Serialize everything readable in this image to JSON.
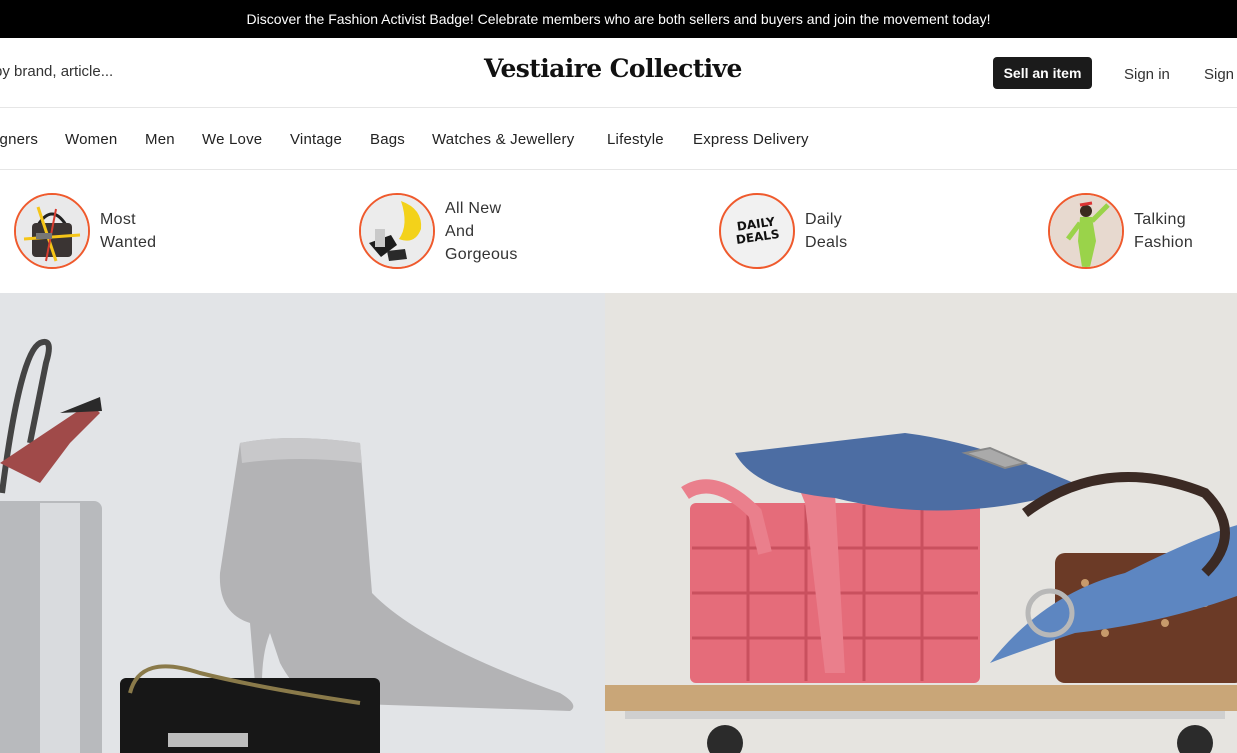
{
  "announcement": "Discover the Fashion Activist Badge! Celebrate members who are both sellers and buyers and join the movement today!",
  "header": {
    "search_text": "by brand, article...",
    "logo": "Vestiaire Collective",
    "sell_label": "Sell an item",
    "signin_label": "Sign in",
    "signup_label": "Sign"
  },
  "nav": {
    "items": [
      "igners",
      "Women",
      "Men",
      "We Love",
      "Vintage",
      "Bags",
      "Watches & Jewellery",
      "Lifestyle",
      "Express Delivery"
    ]
  },
  "categories": [
    {
      "lines": [
        "Most",
        "Wanted"
      ]
    },
    {
      "lines": [
        "All New",
        "And",
        "Gorgeous"
      ]
    },
    {
      "lines": [
        "Daily",
        "Deals"
      ],
      "badge": [
        "DAILY",
        "DEALS"
      ]
    },
    {
      "lines": [
        "Talking",
        "Fashion"
      ]
    }
  ],
  "colors": {
    "accent_ring": "#ef5a2d",
    "button_bg": "#1b1b1b",
    "announcement_bg": "#000000"
  }
}
